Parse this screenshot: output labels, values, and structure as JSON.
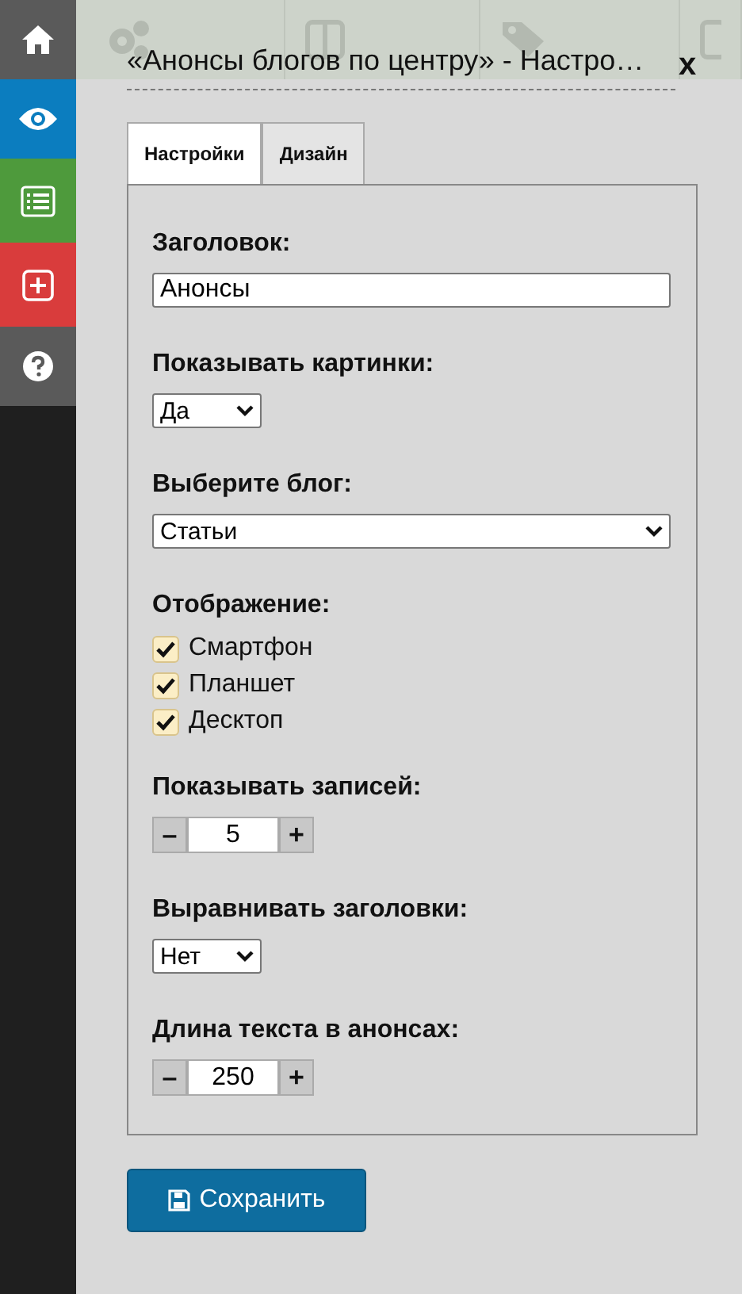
{
  "sidebar": {
    "items": [
      {
        "kind": "home",
        "color": "#5a5a5a"
      },
      {
        "kind": "eye",
        "color": "#0b7dbf"
      },
      {
        "kind": "list",
        "color": "#4e9a3c"
      },
      {
        "kind": "plus",
        "color": "#d93c3c"
      },
      {
        "kind": "help",
        "color": "#5a5a5a"
      }
    ]
  },
  "toolbar": {
    "items": [
      {
        "kind": "gears"
      },
      {
        "kind": "layout"
      },
      {
        "kind": "tag"
      },
      {
        "kind": "device"
      }
    ]
  },
  "dialog": {
    "title": "«Анонсы блогов по центру» - Настро…",
    "close": "x",
    "tabs": [
      {
        "label": "Настройки",
        "selected": true
      },
      {
        "label": "Дизайн",
        "selected": false
      }
    ],
    "fields": [
      {
        "kind": "text",
        "label": "Заголовок:",
        "value": "Анонсы"
      },
      {
        "kind": "select",
        "label": "Показывать картинки:",
        "value": "Да",
        "wide": false
      },
      {
        "kind": "select",
        "label": "Выберите блог:",
        "value": "Статьи",
        "wide": true
      },
      {
        "kind": "checkboxes",
        "label": "Отображение:",
        "options": [
          {
            "label": "Смартфон",
            "checked": true
          },
          {
            "label": "Планшет",
            "checked": true
          },
          {
            "label": "Десктоп",
            "checked": true
          }
        ]
      },
      {
        "kind": "stepper",
        "label": "Показывать записей:",
        "minus": "–",
        "value": "5",
        "plus": "+"
      },
      {
        "kind": "select",
        "label": "Выравнивать заголовки:",
        "value": "Нет",
        "wide": false
      },
      {
        "kind": "stepper",
        "label": "Длина текста в анонсах:",
        "minus": "–",
        "value": "250",
        "plus": "+"
      }
    ],
    "save_button": "Сохранить"
  }
}
